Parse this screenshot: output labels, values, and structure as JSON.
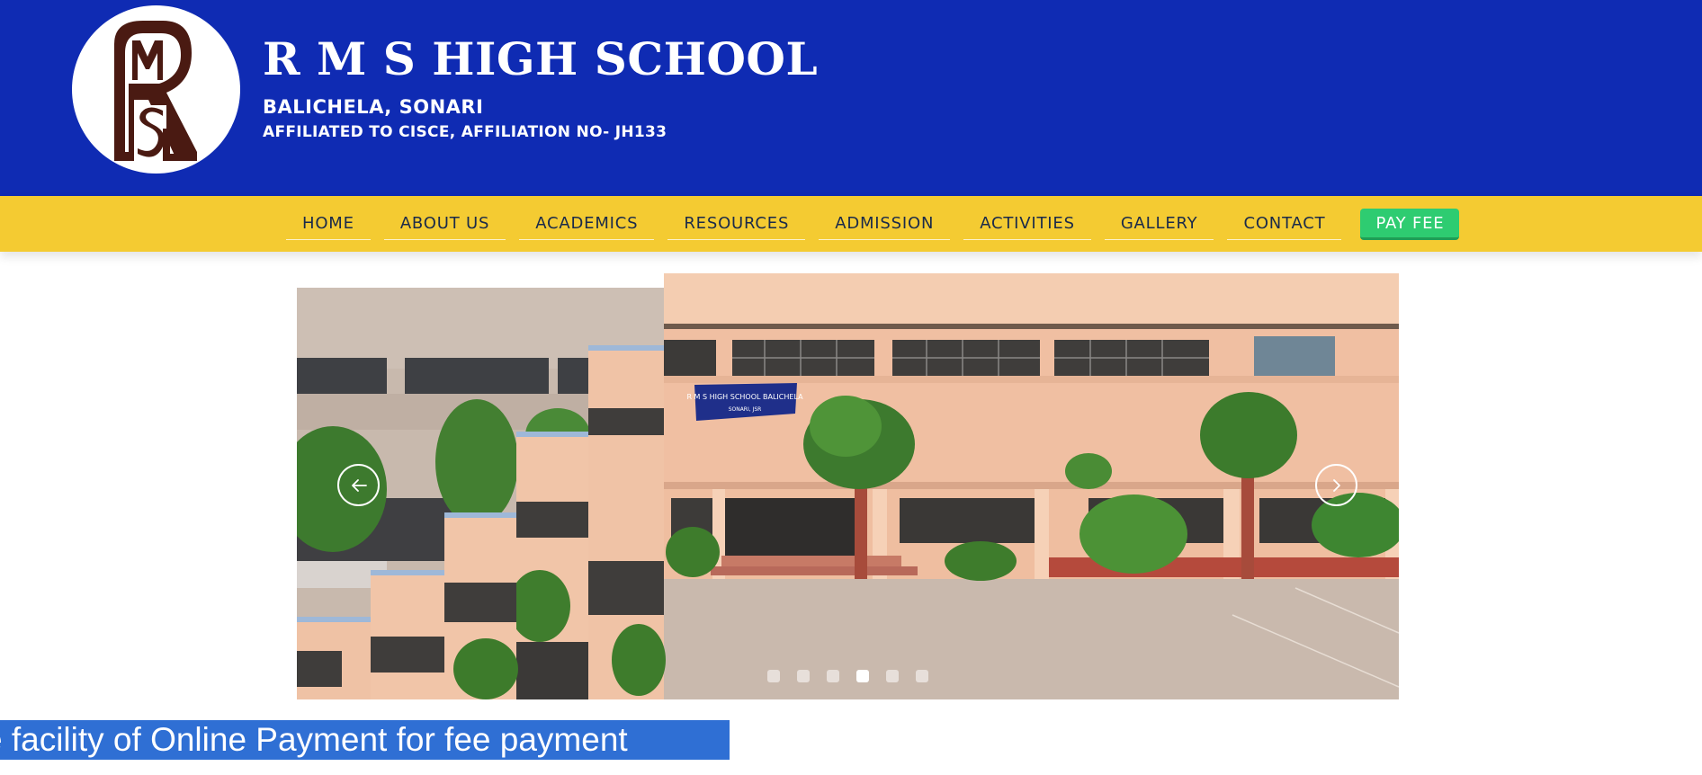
{
  "header": {
    "logo_letters": "RMS",
    "school_name": "R M S HIGH SCHOOL",
    "location": "BALICHELA, SONARI",
    "affiliation": "AFFILIATED TO CISCE, AFFILIATION NO- JH133",
    "colors": {
      "background": "#0f2bb3",
      "logo_brown": "#4a1a12"
    }
  },
  "nav": {
    "items": [
      {
        "label": "HOME"
      },
      {
        "label": "ABOUT US"
      },
      {
        "label": "ACADEMICS"
      },
      {
        "label": "RESOURCES"
      },
      {
        "label": "ADMISSION"
      },
      {
        "label": "ACTIVITIES"
      },
      {
        "label": "GALLERY"
      },
      {
        "label": "CONTACT"
      }
    ],
    "pay_fee_label": "PAY FEE",
    "colors": {
      "background": "#f4cb32",
      "pay_fee": "#2ecc71"
    }
  },
  "slider": {
    "banner_text": "R M S HIGH SCHOOL BALICHELA",
    "banner_subtext": "SONARI, JSR",
    "prev_icon": "arrow-left-icon",
    "next_icon": "chevron-right-icon",
    "slide_count": 6,
    "active_slide": 4
  },
  "marquee": {
    "text": "e facility of Online Payment for fee payment",
    "color": "#2f6fd4"
  }
}
